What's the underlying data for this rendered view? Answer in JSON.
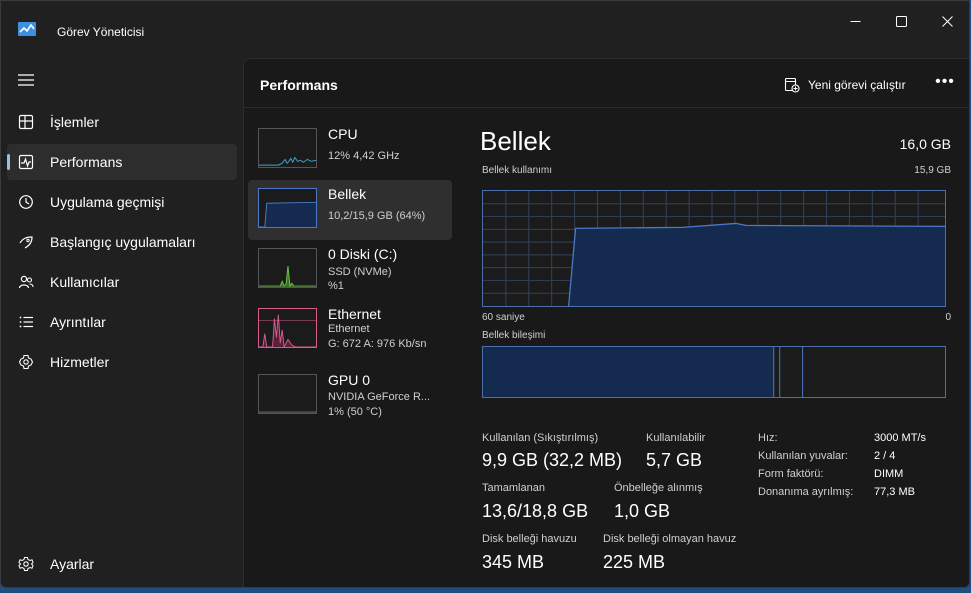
{
  "window": {
    "title": "Görev Yöneticisi"
  },
  "sidebar": {
    "items": [
      {
        "label": "İşlemler",
        "icon": "processes-icon"
      },
      {
        "label": "Performans",
        "icon": "performance-icon"
      },
      {
        "label": "Uygulama geçmişi",
        "icon": "history-icon"
      },
      {
        "label": "Başlangıç uygulamaları",
        "icon": "startup-icon"
      },
      {
        "label": "Kullanıcılar",
        "icon": "users-icon"
      },
      {
        "label": "Ayrıntılar",
        "icon": "details-icon"
      },
      {
        "label": "Hizmetler",
        "icon": "services-icon"
      }
    ],
    "settings_label": "Ayarlar",
    "active_index": 1
  },
  "header": {
    "title": "Performans",
    "run_task_label": "Yeni görevi çalıştır",
    "more_label": "•••"
  },
  "devices": [
    {
      "name": "CPU",
      "line1": "12% 4,42 GHz",
      "line2": "",
      "line3": ""
    },
    {
      "name": "Bellek",
      "line1": "10,2/15,9 GB (64%)",
      "line2": "",
      "line3": ""
    },
    {
      "name": "0 Diski (C:)",
      "line1": "SSD (NVMe)",
      "line2": "%1",
      "line3": ""
    },
    {
      "name": "Ethernet",
      "line1": "Ethernet",
      "line2": "G: 672 A: 976 Kb/sn",
      "line3": ""
    },
    {
      "name": "GPU 0",
      "line1": "NVIDIA GeForce R...",
      "line2": "1% (50 °C)",
      "line3": ""
    }
  ],
  "detail": {
    "title": "Bellek",
    "total": "16,0 GB",
    "usage_label": "Bellek kullanımı",
    "usage_max": "15,9 GB",
    "time_label": "60 saniye",
    "time_end": "0",
    "composition_label": "Bellek bileşimi",
    "usage_fraction": 0.64,
    "stats": {
      "in_use_label": "Kullanılan (Sıkıştırılmış)",
      "in_use_value": "9,9 GB (32,2 MB)",
      "available_label": "Kullanılabilir",
      "available_value": "5,7 GB",
      "committed_label": "Tamamlanan",
      "committed_value": "13,6/18,8 GB",
      "cached_label": "Önbelleğe alınmış",
      "cached_value": "1,0 GB",
      "paged_label": "Disk belleği havuzu",
      "paged_value": "345 MB",
      "nonpaged_label": "Disk belleği olmayan havuz",
      "nonpaged_value": "225 MB"
    },
    "specs": [
      {
        "label": "Hız:",
        "value": "3000 MT/s"
      },
      {
        "label": "Kullanılan yuvalar:",
        "value": "2 / 4"
      },
      {
        "label": "Form faktörü:",
        "value": "DIMM"
      },
      {
        "label": "Donanıma ayrılmış:",
        "value": "77,3 MB"
      }
    ]
  },
  "colors": {
    "accent": "#9fb9e8",
    "memory_line": "#4b78c8",
    "memory_fill": "#142a4e",
    "cpu_line": "#3aa4d6",
    "disk_line": "#6cc24a",
    "ethernet_line": "#d65a8a"
  }
}
